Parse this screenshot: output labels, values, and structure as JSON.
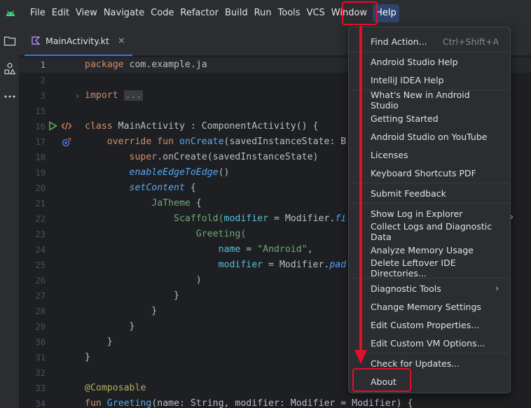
{
  "menubar": {
    "items": [
      "File",
      "Edit",
      "View",
      "Navigate",
      "Code",
      "Refactor",
      "Build",
      "Run",
      "Tools",
      "VCS",
      "Window",
      "Help"
    ],
    "active": "Help"
  },
  "tab": {
    "label": "MainActivity.kt",
    "close": "×"
  },
  "editor": {
    "lines": [
      {
        "n": "1"
      },
      {
        "n": "2"
      },
      {
        "n": "3"
      },
      {
        "n": "15"
      },
      {
        "n": "16"
      },
      {
        "n": "17"
      },
      {
        "n": "18"
      },
      {
        "n": "19"
      },
      {
        "n": "20"
      },
      {
        "n": "21"
      },
      {
        "n": "22"
      },
      {
        "n": "23"
      },
      {
        "n": "24"
      },
      {
        "n": "25"
      },
      {
        "n": "26"
      },
      {
        "n": "27"
      },
      {
        "n": "28"
      },
      {
        "n": "29"
      },
      {
        "n": "30"
      },
      {
        "n": "31"
      },
      {
        "n": "32"
      },
      {
        "n": "33"
      },
      {
        "n": "34"
      }
    ],
    "t": {
      "package_kw": "package",
      "package_name": " com.example.ja",
      "import_kw": "import",
      "import_fold": "...",
      "class_kw": "class",
      "class_name": " MainActivity : ComponentActivity() {",
      "override_kw": "override fun",
      "oncreate": "onCreate",
      "oncreate_args": "(savedInstanceState: B",
      "super_kw": "super",
      "super_call": ".onCreate(savedInstanceState)",
      "edge": "enableEdgeToEdge",
      "edge_paren": "()",
      "setcontent": "setContent",
      "brace_open": " {",
      "jatheme": "JaTheme",
      "scaffold": "Scaffold(",
      "modifier_param": "modifier",
      "scaffold_rest": " = Modifier.",
      "scaffold_fi": "fi",
      "greeting_call": "Greeting(",
      "name_param": "name",
      "eq": " = ",
      "android_str": "\"Android\"",
      "comma": ",",
      "modifier_param2": "modifier",
      "mod_eq": " = Modifier.",
      "pad": "pad",
      "close_paren": ")",
      "close_brace": "}",
      "composable": "@Composable",
      "fun_kw": "fun",
      "greeting_fn": "Greeting",
      "greeting_sig": "(name: String, modifier: Modifier = Modifier) {"
    }
  },
  "help_menu": {
    "items": [
      {
        "label": "Find Action...",
        "shortcut": "Ctrl+Shift+A"
      },
      {
        "label": "Android Studio Help"
      },
      {
        "label": "IntelliJ IDEA Help"
      },
      {
        "label": "What's New in Android Studio"
      },
      {
        "label": "Getting Started"
      },
      {
        "label": "Android Studio on YouTube"
      },
      {
        "label": "Licenses"
      },
      {
        "label": "Keyboard Shortcuts PDF"
      },
      {
        "label": "Submit Feedback"
      },
      {
        "label": "Show Log in Explorer"
      },
      {
        "label": "Collect Logs and Diagnostic Data"
      },
      {
        "label": "Analyze Memory Usage"
      },
      {
        "label": "Delete Leftover IDE Directories..."
      },
      {
        "label": "Diagnostic Tools",
        "arrow": "›"
      },
      {
        "label": "Change Memory Settings"
      },
      {
        "label": "Edit Custom Properties..."
      },
      {
        "label": "Edit Custom VM Options..."
      },
      {
        "label": "Check for Updates..."
      },
      {
        "label": "About"
      }
    ]
  },
  "colors": {
    "annotation": "#e0102a",
    "accent": "#3574f0",
    "menu_bg": "#2b2d30",
    "editor_bg": "#1e1f22"
  },
  "icons": [
    "android-logo-icon",
    "folder-icon",
    "structure-icon",
    "more-icon",
    "kotlin-file-icon",
    "close-icon",
    "run-gutter-icon",
    "code-gutter-icon",
    "override-gutter-icon",
    "chevron-right-icon"
  ]
}
